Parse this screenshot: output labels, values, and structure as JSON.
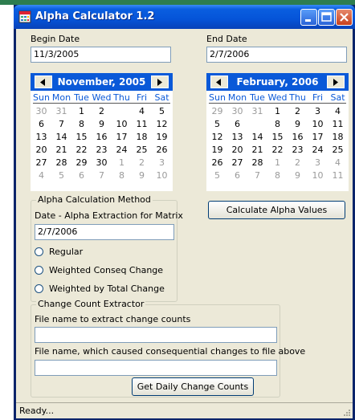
{
  "window": {
    "title": "Alpha Calculator 1.2",
    "minimize_label": "minimize",
    "maximize_label": "maximize",
    "close_label": "close"
  },
  "begin_date": {
    "label": "Begin Date",
    "value": "11/3/2005",
    "calendar": {
      "title": "November, 2005",
      "days_of_week": [
        "Sun",
        "Mon",
        "Tue",
        "Wed",
        "Thu",
        "Fri",
        "Sat"
      ],
      "weeks": [
        [
          "30",
          "31",
          "1",
          "2",
          "3",
          "4",
          "5"
        ],
        [
          "6",
          "7",
          "8",
          "9",
          "10",
          "11",
          "12"
        ],
        [
          "13",
          "14",
          "15",
          "16",
          "17",
          "18",
          "19"
        ],
        [
          "20",
          "21",
          "22",
          "23",
          "24",
          "25",
          "26"
        ],
        [
          "27",
          "28",
          "29",
          "30",
          "1",
          "2",
          "3"
        ],
        [
          "4",
          "5",
          "6",
          "7",
          "8",
          "9",
          "10"
        ]
      ],
      "selected_day": "3"
    }
  },
  "end_date": {
    "label": "End Date",
    "value": "2/7/2006",
    "calendar": {
      "title": "February, 2006",
      "days_of_week": [
        "Sun",
        "Mon",
        "Tue",
        "Wed",
        "Thu",
        "Fri",
        "Sat"
      ],
      "weeks": [
        [
          "29",
          "30",
          "31",
          "1",
          "2",
          "3",
          "4"
        ],
        [
          "5",
          "6",
          "7",
          "8",
          "9",
          "10",
          "11"
        ],
        [
          "12",
          "13",
          "14",
          "15",
          "16",
          "17",
          "18"
        ],
        [
          "19",
          "20",
          "21",
          "22",
          "23",
          "24",
          "25"
        ],
        [
          "26",
          "27",
          "28",
          "1",
          "2",
          "3",
          "4"
        ],
        [
          "5",
          "6",
          "7",
          "8",
          "9",
          "10",
          "11"
        ]
      ],
      "selected_day": "7"
    }
  },
  "alpha_method": {
    "legend": "Alpha Calculation Method",
    "extraction_label": "Date - Alpha Extraction for Matrix",
    "extraction_value": "2/7/2006",
    "options": [
      "Regular",
      "Weighted Conseq Change",
      "Weighted by Total Change"
    ]
  },
  "calculate_button": "Calculate Alpha Values",
  "change_count": {
    "legend": "Change Count Extractor",
    "file_label": "File name to extract change counts",
    "file_value": "",
    "cause_label": "File name, which caused consequential changes to file above",
    "cause_value": "",
    "button": "Get Daily Change Counts"
  },
  "status": {
    "text": "Ready..."
  },
  "colors": {
    "title_bar": "#0554d8",
    "calendar_header": "#0a59d8",
    "dialog_background": "#ece9d8",
    "other_month_day": "#9a9a9a"
  },
  "icons": [
    "app-calculator-icon",
    "minimize-icon",
    "maximize-icon",
    "close-icon",
    "prev-month-icon",
    "next-month-icon",
    "size-grip-icon"
  ]
}
